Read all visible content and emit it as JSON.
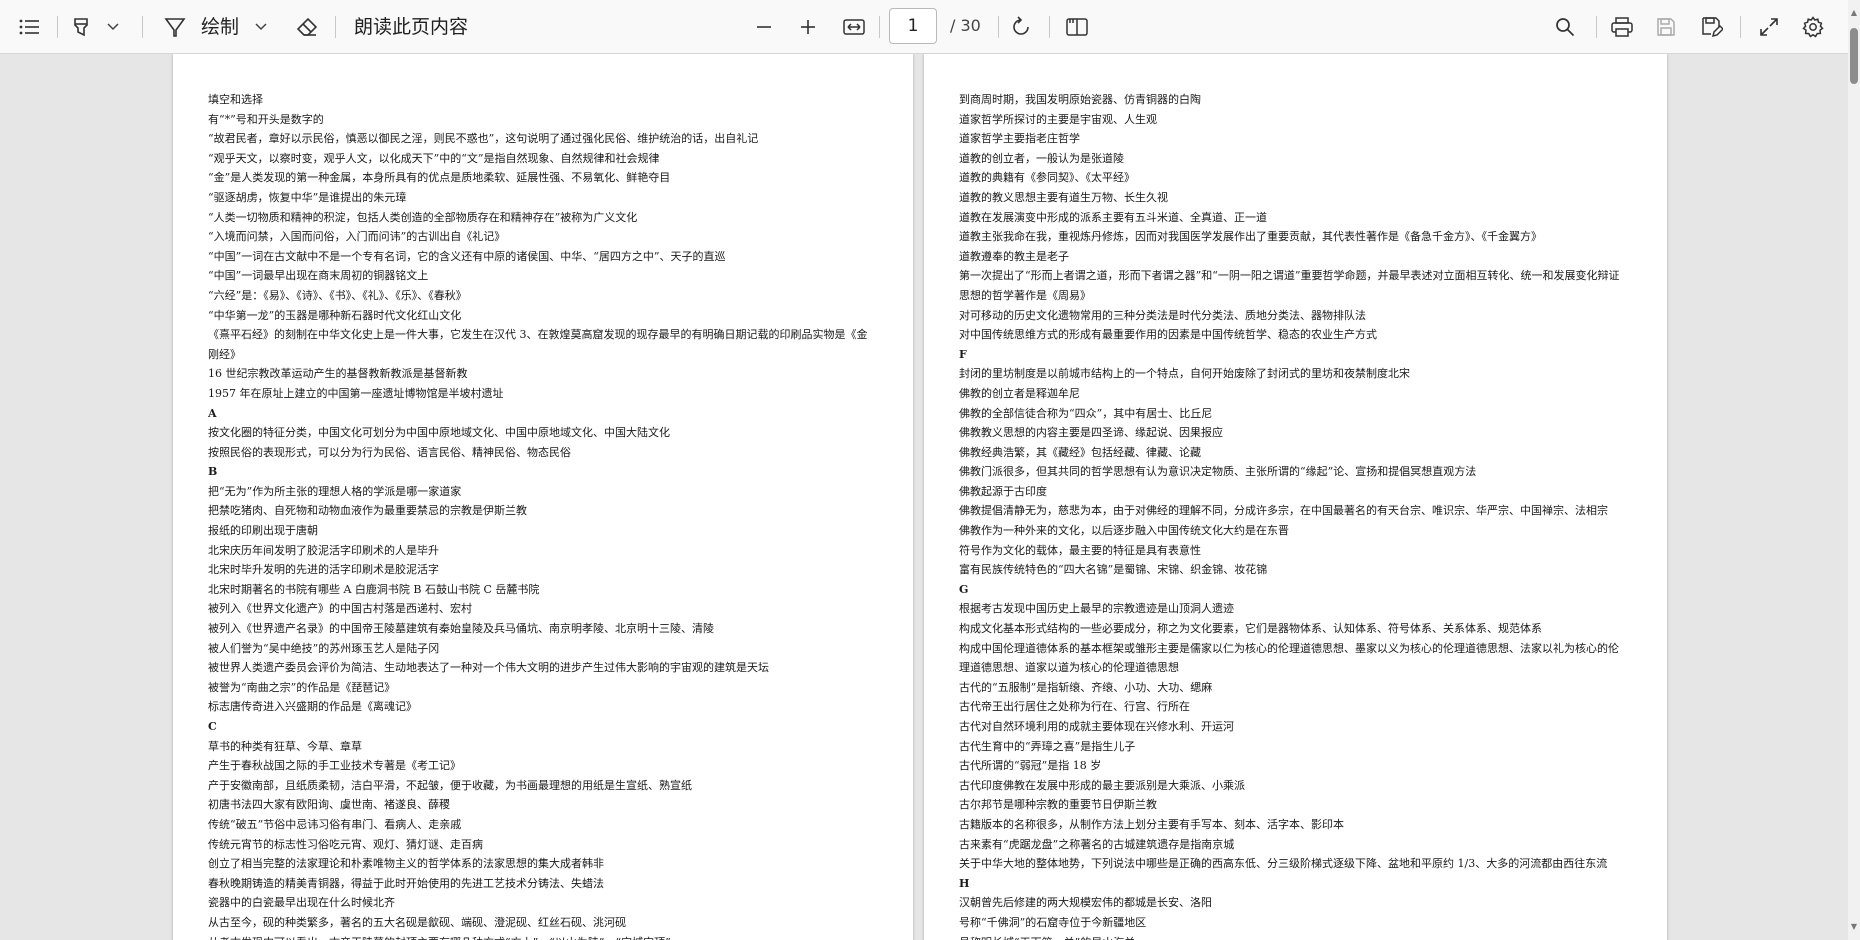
{
  "toolbar": {
    "draw_label": "绘制",
    "read_aloud_label": "朗读此页内容",
    "page_current": "1",
    "page_total": "/ 30",
    "icons": [
      "contents-icon",
      "highlight-icon",
      "chevron-down-icon",
      "draw-icon",
      "chevron-down-icon",
      "eraser-icon",
      "zoom-out-icon",
      "zoom-in-icon",
      "fit-width-icon",
      "rotate-icon",
      "page-view-icon",
      "search-icon",
      "print-icon",
      "save-icon",
      "save-as-icon",
      "fullscreen-icon",
      "settings-icon"
    ]
  },
  "pages": {
    "left": [
      "填空和选择",
      "有“*”号和开头是数字的",
      "“故君民者，章好以示民俗，慎恶以御民之淫，则民不惑也”，这句说明了通过强化民俗、维护统治的话，出自礼记",
      "“观乎天文，以察时变，观乎人文，以化成天下”中的“文”是指自然现象、自然规律和社会规律",
      "“金”是人类发现的第一种金属，本身所具有的优点是质地柔软、延展性强、不易氧化、鲜艳夺目",
      "“驱逐胡虏，恢复中华”是谁提出的朱元璋",
      "“人类一切物质和精神的积淀，包括人类创造的全部物质存在和精神存在”被称为广义文化",
      "“入境而问禁，入国而问俗，入门而问讳”的古训出自《礼记》",
      "“中国”一词在古文献中不是一个专有名词，它的含义还有中原的诸侯国、中华、“居四方之中”、天子的直巡",
      "“中国”一词最早出现在商末周初的铜器铭文上",
      " “六经”是：《易》、《诗》、《书》、《礼》、《乐》、《春秋》",
      " “中华第一龙”的玉器是哪种新石器时代文化红山文化",
      "《熹平石经》的刻制在中华文化史上是一件大事，它发生在汉代 3、在敦煌莫高窟发现的现存最早的有明确日期记载的印刷品实物是《金",
      "刚经》",
      "16 世纪宗教改革运动产生的基督教新教派是基督新教",
      "1957 年在原址上建立的中国第一座遗址博物馆是半坡村遗址",
      "A",
      "按文化圈的特征分类，中国文化可划分为中国中原地域文化、中国中原地域文化、中国大陆文化",
      "按照民俗的表现形式，可以分为行为民俗、语言民俗、精神民俗、物态民俗",
      "B",
      "把“无为”作为所主张的理想人格的学派是哪一家道家",
      "把禁吃猪肉、自死物和动物血液作为最重要禁忌的宗教是伊斯兰教",
      "报纸的印刷出现于唐朝",
      "北宋庆历年间发明了胶泥活字印刷术的人是毕升",
      "北宋时毕升发明的先进的活字印刷术是胶泥活字",
      "北宋时期著名的书院有哪些 A 白鹿洞书院 B 石鼓山书院 C 岳麓书院",
      "被列入《世界文化遗产》的中国古村落是西递村、宏村",
      "被列入《世界遗产名录》的中国帝王陵墓建筑有秦始皇陵及兵马俑坑、南京明孝陵、北京明十三陵、清陵",
      "被人们誉为“吴中绝技”的苏州琢玉艺人是陆子冈",
      "被世界人类遗产委员会评价为简洁、生动地表达了一种对一个伟大文明的进步产生过伟大影响的宇宙观的建筑是天坛",
      "被誉为“南曲之宗”的作品是《琵琶记》",
      "标志唐传奇进入兴盛期的作品是《离魂记》",
      "C",
      "草书的种类有狂草、今草、章草",
      "产生于春秋战国之际的手工业技术专著是《考工记》",
      "产于安徽南部，且纸质柔韧，洁白平滑，不起皱，便于收藏，为书画最理想的用纸是生宣纸、熟宣纸",
      "初唐书法四大家有欧阳询、虞世南、褚遂良、薛稷",
      "传统“破五”节俗中忌讳习俗有串门、看病人、走亲戚",
      "传统元宵节的标志性习俗吃元宵、观灯、猜灯谜、走百病",
      "创立了相当完整的法家理论和朴素唯物主义的哲学体系的法家思想的集大成者韩非",
      "春秋晚期铸造的精美青铜器，得益于此时开始使用的先进工艺技术分铸法、失蜡法",
      "瓷器中的白瓷最早出现在什么时候北齐",
      "从古至今，砚的种类繁多，著名的五大名砚是歙砚、端砚、澄泥砚、红丝石砚、洮河砚",
      "从考古发现中可以看出，古帝王陵墓的封顶主要有哪几种方式“方上”、“以山为陵”、“宝城宝顶”"
    ],
    "right": [
      "到商周时期，我国发明原始瓷器、仿青铜器的白陶",
      "道家哲学所探讨的主要是宇宙观、人生观",
      "道家哲学主要指老庄哲学",
      "道教的创立者，一般认为是张道陵",
      "道教的典籍有《参同契》、《太平经》",
      "道教的教义思想主要有道生万物、长生久视",
      "道教在发展演变中形成的派系主要有五斗米道、全真道、正一道",
      "道教主张我命在我，重视炼丹修炼，因而对我国医学发展作出了重要贡献，其代表性著作是《备急千金方》、《千金翼方》",
      "道教遵奉的教主是老子",
      "第一次提出了“形而上者谓之道，形而下者谓之器”和“一阴一阳之谓道”重要哲学命题，并最早表述对立面相互转化、统一和发展变化辩证",
      "思想的哲学著作是《周易》",
      "对可移动的历史文化遗物常用的三种分类法是时代分类法、质地分类法、器物排队法",
      "对中国传统思维方式的形成有最重要作用的因素是中国传统哲学、稳态的农业生产方式",
      "F",
      "封闭的里坊制度是以前城市结构上的一个特点，自何开始废除了封闭式的里坊和夜禁制度北宋",
      "佛教的创立者是释迦牟尼",
      "佛教的全部信徒合称为“四众”，其中有居士、比丘尼",
      "佛教教义思想的内容主要是四圣谛、缘起说、因果报应",
      "佛教经典浩繁，其《藏经》包括经藏、律藏、论藏",
      "佛教门派很多，但其共同的哲学思想有认为意识决定物质、主张所谓的“缘起”论、宣扬和提倡冥想直观方法",
      "佛教起源于古印度",
      "佛教提倡清静无为，慈悲为本，由于对佛经的理解不同，分成许多宗，在中国最著名的有天台宗、唯识宗、华严宗、中国禅宗、法相宗",
      "佛教作为一种外来的文化，以后逐步融入中国传统文化大约是在东晋",
      "符号作为文化的载体，最主要的特征是具有表意性",
      "富有民族传统特色的“四大名锦”是蜀锦、宋锦、织金锦、妆花锦",
      "G",
      "根据考古发现中国历史上最早的宗教遗迹是山顶洞人遗迹",
      "构成文化基本形式结构的一些必要成分，称之为文化要素，它们是器物体系、认知体系、符号体系、关系体系、规范体系",
      "构成中国伦理道德体系的基本框架或雏形主要是儒家以仁为核心的伦理道德思想、墨家以义为核心的伦理道德思想、法家以礼为核心的伦",
      "理道德思想、道家以道为核心的伦理道德思想",
      "古代的“五服制”是指斩缞、齐缞、小功、大功、缌麻",
      "古代帝王出行居住之处称为行在、行宫、行所在",
      "古代对自然环境利用的成就主要体现在兴修水利、开运河",
      "古代生育中的“弄璋之喜”是指生儿子",
      "古代所谓的“弱冠”是指 18 岁",
      "古代印度佛教在发展中形成的最主要派别是大乘派、小乘派",
      "古尔邦节是哪种宗教的重要节日伊斯兰教",
      "古籍版本的名称很多，从制作方法上划分主要有手写本、刻本、活字本、影印本",
      "古来素有“虎踞龙盘”之称著名的古城建筑遗存是指南京城",
      "关于中华大地的整体地势，下列说法中哪些是正确的西高东低、分三级阶梯式逐级下降、盆地和平原约 1/3、大多的河流都由西往东流",
      "H",
      "汉朝曾先后修建的两大规模宏伟的都城是长安、洛阳",
      "号称“千佛洞”的石窟寺位于今新疆地区",
      "号称明长城“天下第一关”的是山海关"
    ]
  }
}
